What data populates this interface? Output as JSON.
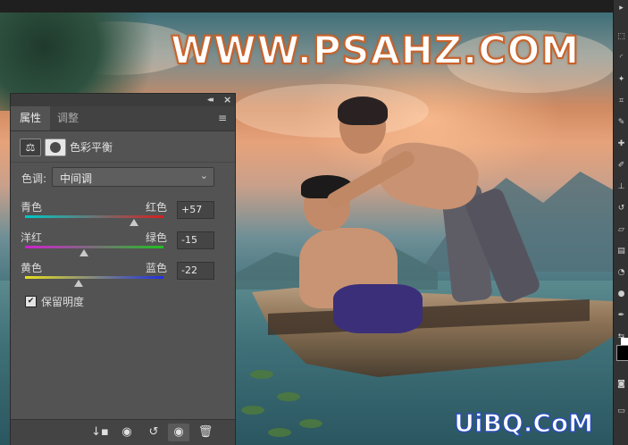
{
  "watermark_top": "WWW.PSAHZ.COM",
  "watermark_bottom": "UiBQ.CoM",
  "panel": {
    "tabs": [
      {
        "label": "属性",
        "active": true
      },
      {
        "label": "调整",
        "active": false
      }
    ],
    "title": "色彩平衡",
    "tone": {
      "label": "色调:",
      "value": "中间调"
    },
    "sliders": [
      {
        "left": "青色",
        "right": "红色",
        "value": "+57",
        "level": 57,
        "gradient": [
          "#00c8c8",
          "#d42020"
        ]
      },
      {
        "left": "洋红",
        "right": "绿色",
        "value": "-15",
        "level": -15,
        "gradient": [
          "#d020d0",
          "#20c020"
        ]
      },
      {
        "left": "黄色",
        "right": "蓝色",
        "value": "-22",
        "level": -22,
        "gradient": [
          "#e6e020",
          "#2030e0"
        ]
      }
    ],
    "preserve_luminosity": {
      "label": "保留明度",
      "checked": true
    },
    "icons": [
      "balance-scale-icon",
      "layer-mask-icon",
      "menu-icon",
      "collapse-icon",
      "close-icon",
      "chevron-down-icon",
      "clip-to-layer-icon",
      "view-previous-icon",
      "reset-icon",
      "visibility-eye-icon",
      "trash-icon"
    ]
  },
  "colors": {
    "panel_bg": "#535353",
    "watermark_stroke": "#c8622a",
    "watermark2_stroke": "#2a4fb5"
  }
}
